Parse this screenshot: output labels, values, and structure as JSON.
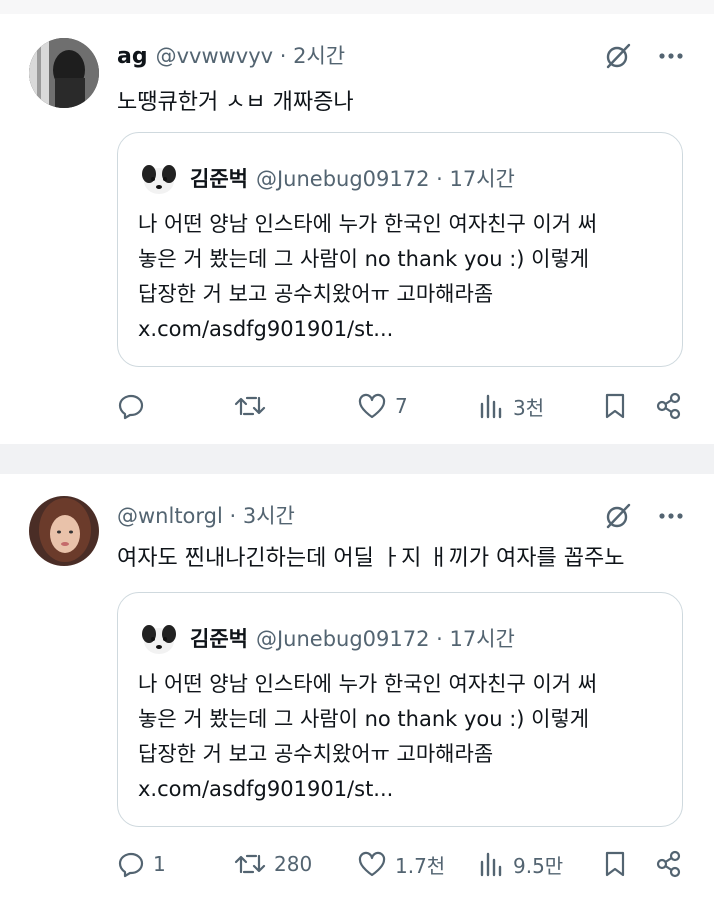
{
  "tweets": [
    {
      "author_name": "ag",
      "author_handle": "@vvwwvyv · 2시간",
      "text": "노땡큐한거 ㅅㅂ 개짜증나",
      "quote": {
        "author_name": "김준벅",
        "author_handle": "@Junebug09172 · 17시간",
        "text": "나 어떤 양남 인스타에 누가 한국인 여자친구 이거 써\n놓은 거 봤는데 그 사람이 no thank you :) 이렇게\n답장한 거 보고 공수치왔어ㅠ 고마해라좀\nx.com/asdfg901901/st..."
      },
      "replies": "",
      "retweets": "",
      "likes": "7",
      "views": "3천"
    },
    {
      "author_name": "",
      "author_handle": "@wnltorgl · 3시간",
      "text": "여자도 찐내나긴하는데 어딜 ㅏ지 ㅐ끼가 여자를 꼽주노",
      "quote": {
        "author_name": "김준벅",
        "author_handle": "@Junebug09172 · 17시간",
        "text": "나 어떤 양남 인스타에 누가 한국인 여자친구 이거 써\n놓은 거 봤는데 그 사람이 no thank you :) 이렇게\n답장한 거 보고 공수치왔어ㅠ 고마해라좀\nx.com/asdfg901901/st..."
      },
      "replies": "1",
      "retweets": "280",
      "likes": "1.7천",
      "views": "9.5만"
    }
  ],
  "icons": {
    "grok": "grok-icon",
    "more": "more-icon",
    "reply": "reply-icon",
    "retweet": "retweet-icon",
    "like": "like-icon",
    "views": "views-icon",
    "bookmark": "bookmark-icon",
    "share": "share-icon"
  },
  "colors": {
    "text": "#0f1419",
    "secondary": "#536471",
    "border": "#cfd9de"
  }
}
